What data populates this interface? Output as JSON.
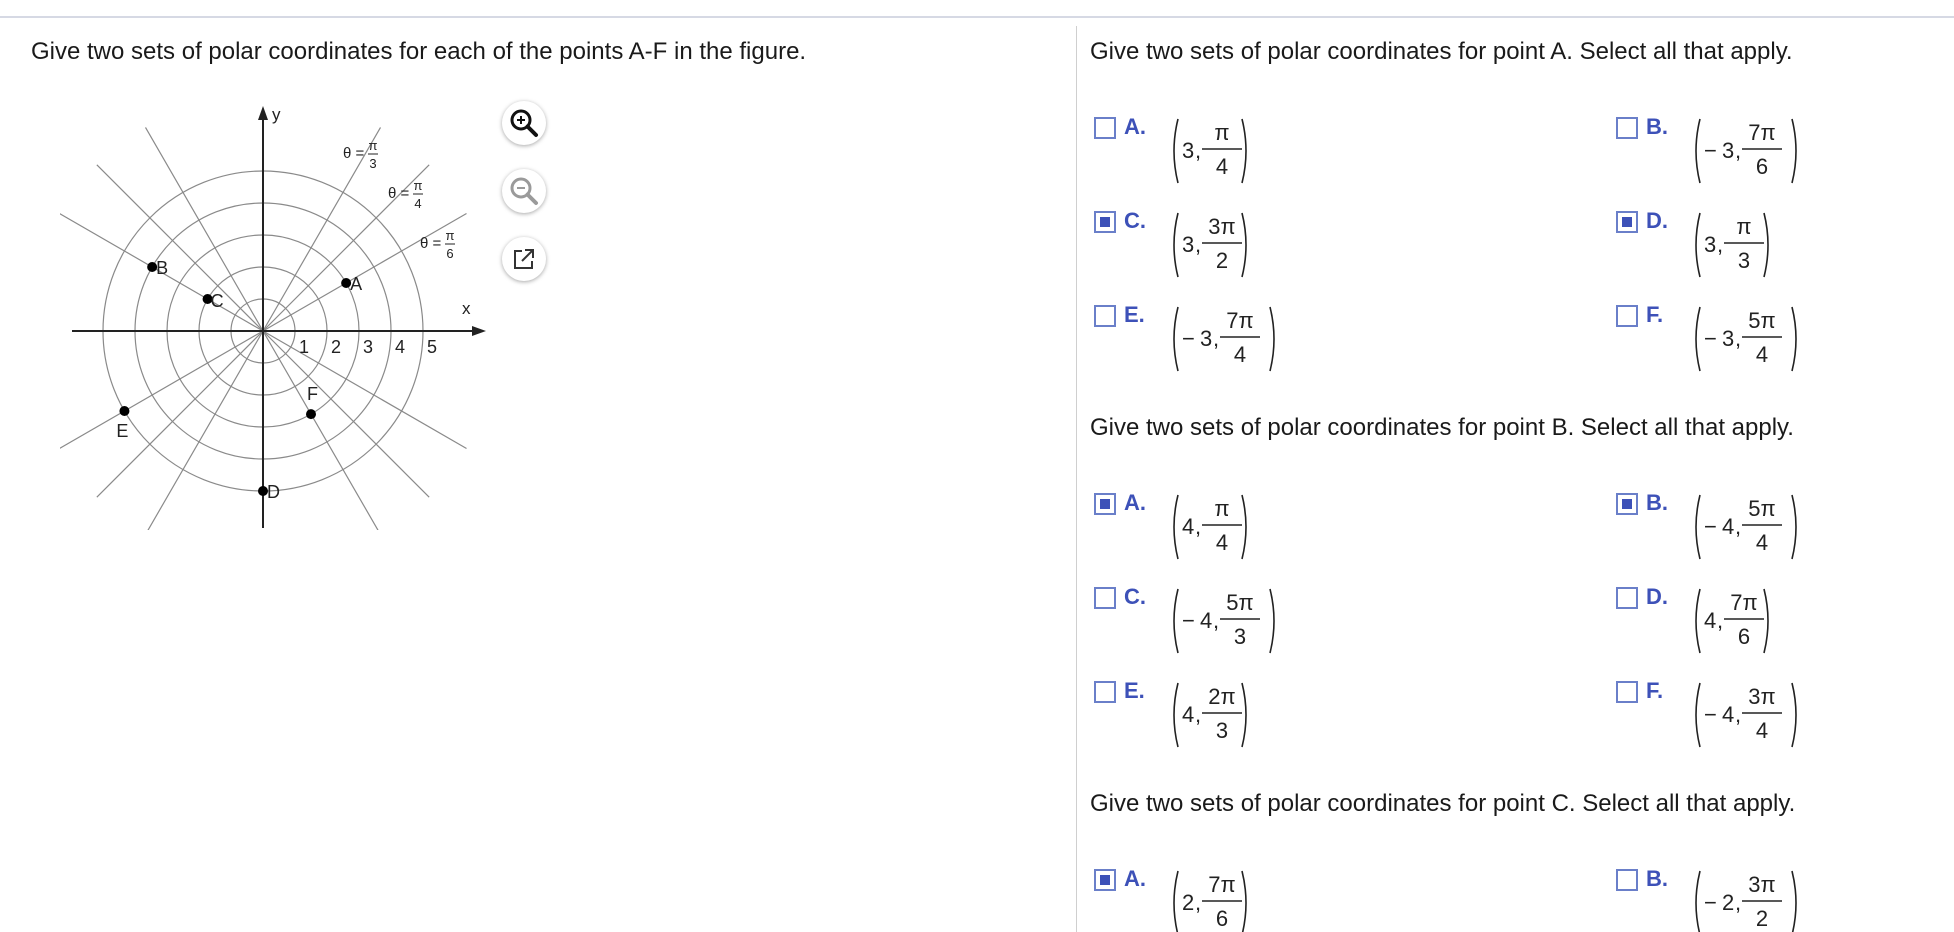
{
  "left": {
    "question": "Give two sets of polar coordinates for each of the points A-F in the figure.",
    "figure": {
      "axis_x_label": "x",
      "axis_y_label": "y",
      "radius_labels": [
        "1",
        "2",
        "3",
        "4",
        "5"
      ],
      "angle_labels": [
        {
          "theta": "θ =",
          "num": "π",
          "den": "3"
        },
        {
          "theta": "θ =",
          "num": "π",
          "den": "4"
        },
        {
          "theta": "θ =",
          "num": "π",
          "den": "6"
        }
      ],
      "points": [
        {
          "label": "A",
          "r": 3,
          "angle": "π/6"
        },
        {
          "label": "B",
          "r": 4,
          "angle": "5π/6"
        },
        {
          "label": "C",
          "r": 2,
          "angle": "5π/6"
        },
        {
          "label": "D",
          "r": 5,
          "angle": "3π/2"
        },
        {
          "label": "E",
          "r": 5,
          "angle": "7π/6"
        },
        {
          "label": "F",
          "r": 3,
          "angle": "5π/3"
        }
      ]
    },
    "tools": [
      {
        "icon": "zoom-in-icon"
      },
      {
        "icon": "zoom-out-icon"
      },
      {
        "icon": "popout-icon"
      }
    ]
  },
  "questions": [
    {
      "prompt": "Give two sets of polar coordinates for point A. Select all that apply.",
      "options": [
        {
          "letter": "A.",
          "sign": "",
          "r": "3",
          "num": "π",
          "den": "4",
          "checked": false
        },
        {
          "letter": "B.",
          "sign": "−",
          "r": "3",
          "num": "7π",
          "den": "6",
          "checked": false
        },
        {
          "letter": "C.",
          "sign": "",
          "r": "3",
          "num": "3π",
          "den": "2",
          "checked": true
        },
        {
          "letter": "D.",
          "sign": "",
          "r": "3",
          "num": "π",
          "den": "3",
          "checked": true
        },
        {
          "letter": "E.",
          "sign": "−",
          "r": "3",
          "num": "7π",
          "den": "4",
          "checked": false
        },
        {
          "letter": "F.",
          "sign": "−",
          "r": "3",
          "num": "5π",
          "den": "4",
          "checked": false
        }
      ]
    },
    {
      "prompt": "Give two sets of polar coordinates for point B. Select all that apply.",
      "options": [
        {
          "letter": "A.",
          "sign": "",
          "r": "4",
          "num": "π",
          "den": "4",
          "checked": true
        },
        {
          "letter": "B.",
          "sign": "−",
          "r": "4",
          "num": "5π",
          "den": "4",
          "checked": true
        },
        {
          "letter": "C.",
          "sign": "−",
          "r": "4",
          "num": "5π",
          "den": "3",
          "checked": false
        },
        {
          "letter": "D.",
          "sign": "",
          "r": "4",
          "num": "7π",
          "den": "6",
          "checked": false
        },
        {
          "letter": "E.",
          "sign": "",
          "r": "4",
          "num": "2π",
          "den": "3",
          "checked": false
        },
        {
          "letter": "F.",
          "sign": "−",
          "r": "4",
          "num": "3π",
          "den": "4",
          "checked": false
        }
      ]
    },
    {
      "prompt": "Give two sets of polar coordinates for point C. Select all that apply.",
      "options": [
        {
          "letter": "A.",
          "sign": "",
          "r": "2",
          "num": "7π",
          "den": "6",
          "checked": true
        },
        {
          "letter": "B.",
          "sign": "−",
          "r": "2",
          "num": "3π",
          "den": "2",
          "checked": false
        }
      ]
    }
  ]
}
